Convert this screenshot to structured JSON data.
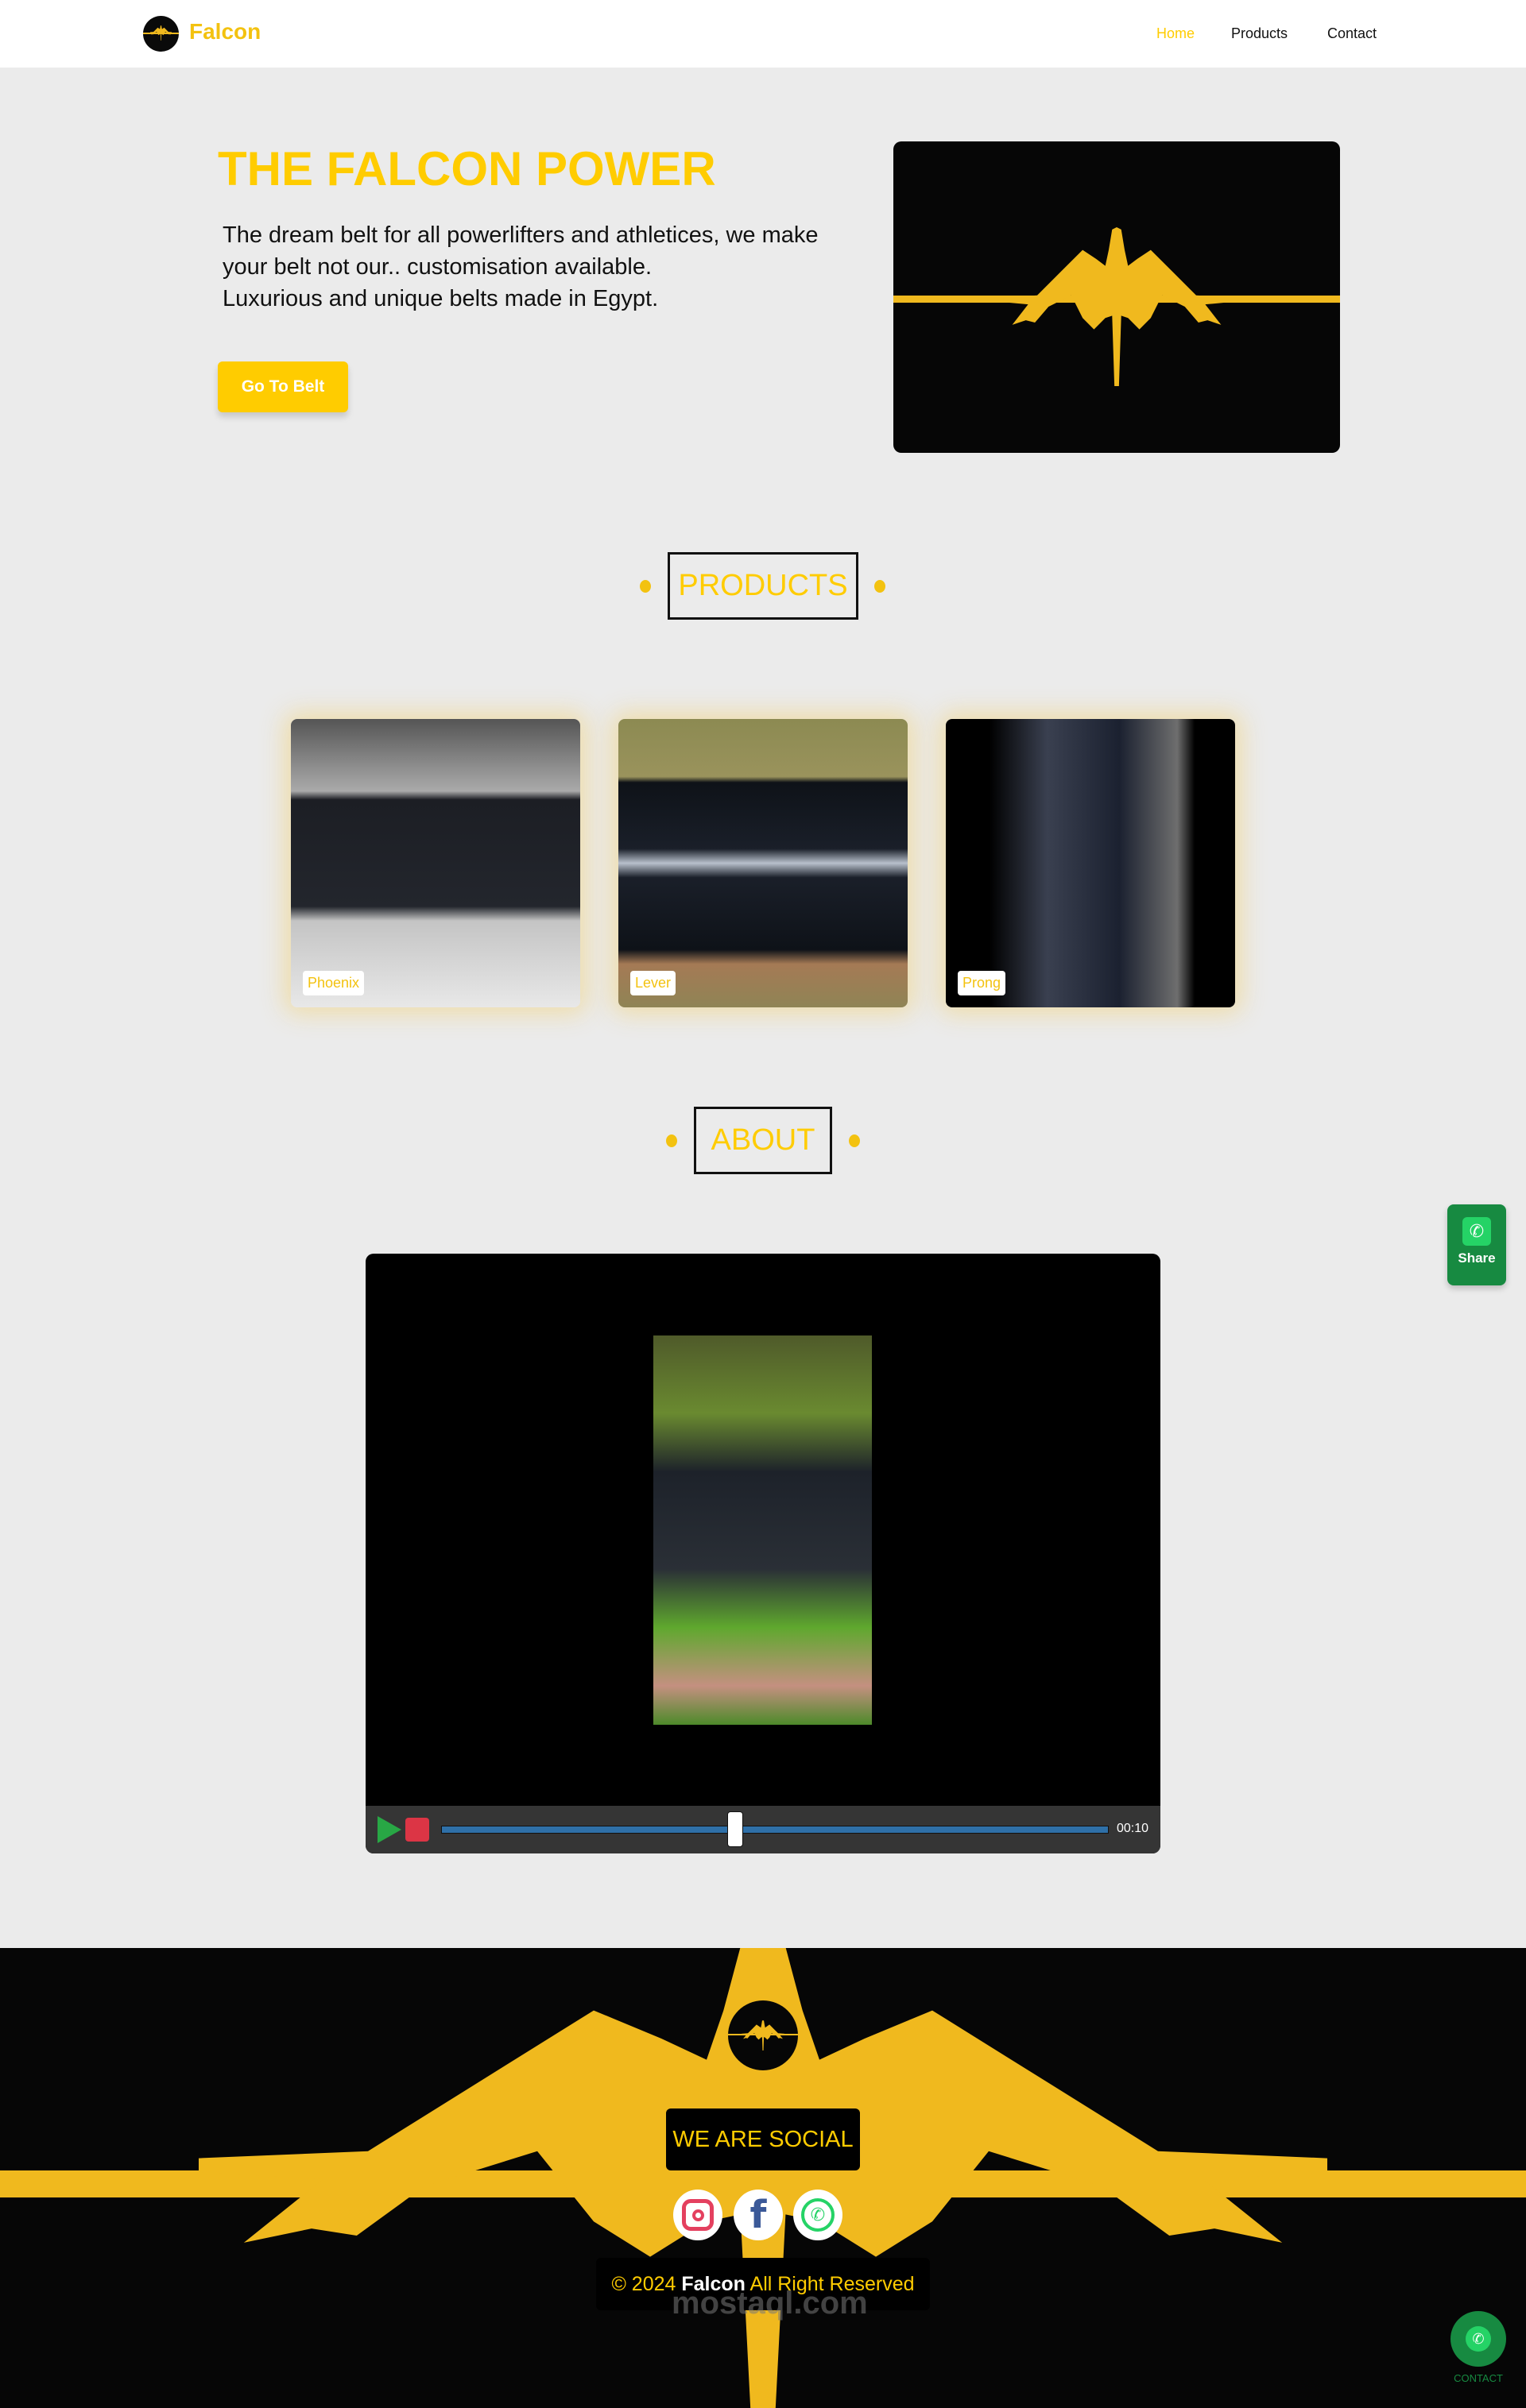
{
  "header": {
    "brand": "Falcon",
    "nav": [
      "Home",
      "Products",
      "Contact"
    ],
    "active": "Home"
  },
  "hero": {
    "title": "THE FALCON POWER",
    "lines": [
      "The dream belt for all powerlifters and athletices, we make",
      "your belt not our.. customisation available.",
      "Luxurious and unique belts made in Egypt."
    ],
    "button": "Go To Belt"
  },
  "products": {
    "heading": "PRODUCTS",
    "items": [
      {
        "label": "Phoenix"
      },
      {
        "label": "Lever"
      },
      {
        "label": "Prong"
      }
    ]
  },
  "about": {
    "heading": "ABOUT",
    "video": {
      "time": "00:10",
      "progress": 0.44
    }
  },
  "share": {
    "label": "Share"
  },
  "footer": {
    "social_heading": "WE ARE SOCIAL",
    "social": [
      "instagram-icon",
      "facebook-icon",
      "whatsapp-icon"
    ],
    "copyright_prefix": "© 2024 ",
    "copyright_brand": "Falcon",
    "copyright_suffix": " All Right Reserved",
    "watermark_text": "mostaql.com",
    "contact": "CONTACT"
  },
  "colors": {
    "accent": "#ffcc00",
    "falcon": "#f0b91e",
    "whatsapp": "#178a41",
    "progress": "#2f70a8",
    "play": "#28a745",
    "stop": "#dc3545"
  }
}
